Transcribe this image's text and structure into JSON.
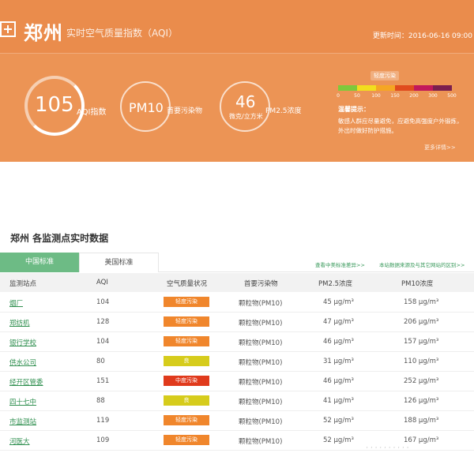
{
  "header": {
    "city": "郑州",
    "subtitle": "实时空气质量指数（AQI）",
    "update_time": "更新时间：2016-06-16 09:00"
  },
  "summary": {
    "aqi": "105",
    "aqi_label": "AQI指数",
    "primary_pollutant": "PM10",
    "primary_label": "首要污染物",
    "pm25": "46",
    "pm25_unit": "微克/立方米",
    "pm25_label": "PM2.5浓度"
  },
  "scale": {
    "level_tag": "轻度污染",
    "colors": [
      "#7ec93b",
      "#f2de1e",
      "#f5a623",
      "#e04b1e",
      "#c2185b",
      "#7b1f4e"
    ],
    "ticks": [
      "0",
      "50",
      "100",
      "150",
      "200",
      "300",
      "500"
    ]
  },
  "advice": {
    "title": "温馨提示：",
    "text": "敏感人群应尽量避免，应避免高强度户外锻炼，外出时做好防护措施。",
    "more": "更多详情>>"
  },
  "stations": {
    "title": "郑州 各监测点实时数据",
    "tabs": [
      "中国标准",
      "美国标准"
    ],
    "link_standard": "查看中美标准差异>>",
    "link_source": "本站数据来源及与其它网站的区别>>",
    "columns": [
      "监测站点",
      "AQI",
      "空气质量状况",
      "首要污染物",
      "PM2.5浓度",
      "PM10浓度"
    ],
    "rows": [
      {
        "name": "烟厂",
        "aqi": "104",
        "status": "轻度污染",
        "color": "#f0862c",
        "pollutant": "颗粒物(PM10)",
        "pm25": "45 μg/m³",
        "pm10": "158 μg/m³"
      },
      {
        "name": "郑纺机",
        "aqi": "128",
        "status": "轻度污染",
        "color": "#f0862c",
        "pollutant": "颗粒物(PM10)",
        "pm25": "47 μg/m³",
        "pm10": "206 μg/m³"
      },
      {
        "name": "银行学校",
        "aqi": "104",
        "status": "轻度污染",
        "color": "#f0862c",
        "pollutant": "颗粒物(PM10)",
        "pm25": "46 μg/m³",
        "pm10": "157 μg/m³"
      },
      {
        "name": "供水公司",
        "aqi": "80",
        "status": "良",
        "color": "#d6cc1c",
        "pollutant": "颗粒物(PM10)",
        "pm25": "31 μg/m³",
        "pm10": "110 μg/m³"
      },
      {
        "name": "经开区管委",
        "aqi": "151",
        "status": "中度污染",
        "color": "#e03a1c",
        "pollutant": "颗粒物(PM10)",
        "pm25": "46 μg/m³",
        "pm10": "252 μg/m³"
      },
      {
        "name": "四十七中",
        "aqi": "88",
        "status": "良",
        "color": "#d6cc1c",
        "pollutant": "颗粒物(PM10)",
        "pm25": "41 μg/m³",
        "pm10": "126 μg/m³"
      },
      {
        "name": "市监测站",
        "aqi": "119",
        "status": "轻度污染",
        "color": "#f0862c",
        "pollutant": "颗粒物(PM10)",
        "pm25": "52 μg/m³",
        "pm10": "188 μg/m³"
      },
      {
        "name": "河医大",
        "aqi": "109",
        "status": "轻度污染",
        "color": "#f0862c",
        "pollutant": "颗粒物(PM10)",
        "pm25": "52 μg/m³",
        "pm10": "167 μg/m³"
      }
    ]
  }
}
